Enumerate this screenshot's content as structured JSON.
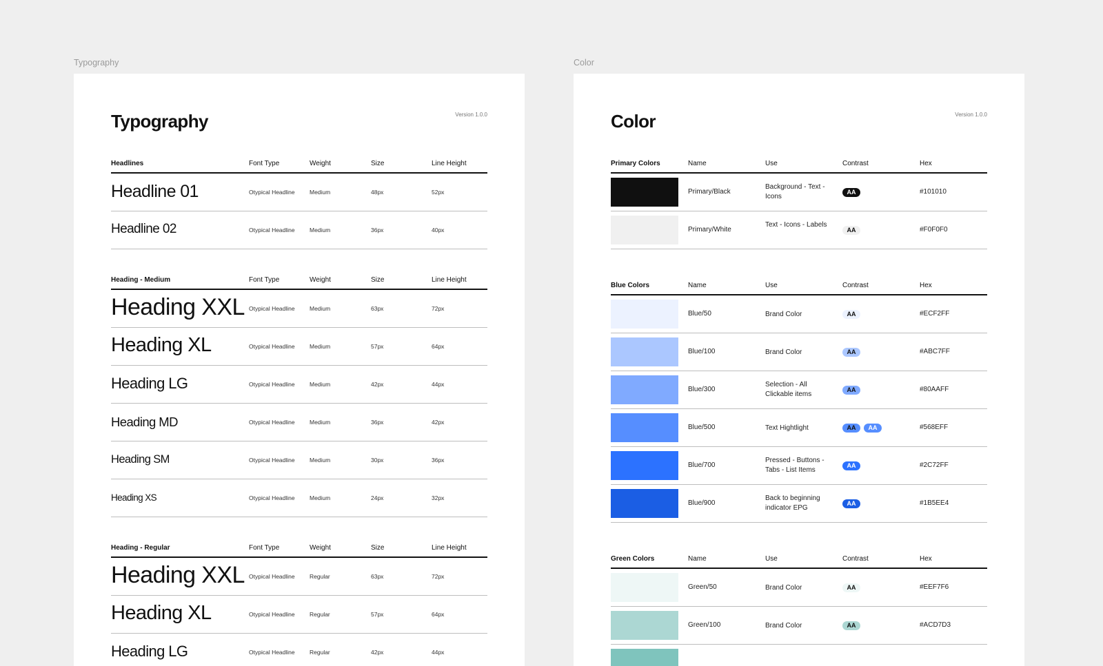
{
  "labels": {
    "typography": "Typography",
    "color": "Color"
  },
  "typography": {
    "title": "Typography",
    "version": "Version 1.0.0",
    "sections": [
      {
        "name": "Headlines",
        "cols": [
          "Font Type",
          "Weight",
          "Size",
          "Line Height"
        ],
        "rows": [
          {
            "sample": "Headline 01",
            "font": "Otypical Headline",
            "weight": "Medium",
            "size": "48px",
            "lh": "52px"
          },
          {
            "sample": "Headline 02",
            "font": "Otypical Headline",
            "weight": "Medium",
            "size": "36px",
            "lh": "40px"
          }
        ]
      },
      {
        "name": "Heading - Medium",
        "cols": [
          "Font Type",
          "Weight",
          "Size",
          "Line Height"
        ],
        "rows": [
          {
            "sample": "Heading XXL",
            "font": "Otypical Headline",
            "weight": "Medium",
            "size": "63px",
            "lh": "72px"
          },
          {
            "sample": "Heading XL",
            "font": "Otypical Headline",
            "weight": "Medium",
            "size": "57px",
            "lh": "64px"
          },
          {
            "sample": "Heading LG",
            "font": "Otypical Headline",
            "weight": "Medium",
            "size": "42px",
            "lh": "44px"
          },
          {
            "sample": "Heading MD",
            "font": "Otypical Headline",
            "weight": "Medium",
            "size": "36px",
            "lh": "42px"
          },
          {
            "sample": "Heading SM",
            "font": "Otypical Headline",
            "weight": "Medium",
            "size": "30px",
            "lh": "36px"
          },
          {
            "sample": "Heading XS",
            "font": "Otypical Headline",
            "weight": "Medium",
            "size": "24px",
            "lh": "32px"
          }
        ]
      },
      {
        "name": "Heading - Regular",
        "cols": [
          "Font Type",
          "Weight",
          "Size",
          "Line Height"
        ],
        "rows": [
          {
            "sample": "Heading XXL",
            "font": "Otypical Headline",
            "weight": "Regular",
            "size": "63px",
            "lh": "72px"
          },
          {
            "sample": "Heading XL",
            "font": "Otypical Headline",
            "weight": "Regular",
            "size": "57px",
            "lh": "64px"
          },
          {
            "sample": "Heading LG",
            "font": "Otypical Headline",
            "weight": "Regular",
            "size": "42px",
            "lh": "44px"
          }
        ]
      }
    ]
  },
  "color": {
    "title": "Color",
    "version": "Version 1.0.0",
    "sections": [
      {
        "name": "Primary Colors",
        "cols": [
          "Name",
          "Use",
          "Contrast",
          "Hex"
        ],
        "rows": [
          {
            "swatch": "#101010",
            "name": "Primary/Black",
            "use": "Background - Text - Icons",
            "aa": [
              {
                "label": "AA",
                "bg": "#101010",
                "fg": "#ffffff"
              }
            ],
            "hex": "#101010"
          },
          {
            "swatch": "#F0F0F0",
            "name": "Primary/White",
            "use": "Text - Icons - Labels",
            "aa": [
              {
                "label": "AA",
                "bg": "#F0F0F0",
                "fg": "#111111"
              }
            ],
            "hex": "#F0F0F0"
          }
        ]
      },
      {
        "name": "Blue Colors",
        "cols": [
          "Name",
          "Use",
          "Contrast",
          "Hex"
        ],
        "rows": [
          {
            "swatch": "#ECF2FF",
            "name": "Blue/50",
            "use": "Brand Color",
            "aa": [
              {
                "label": "AA",
                "bg": "#ECF2FF",
                "fg": "#111111"
              }
            ],
            "hex": "#ECF2FF"
          },
          {
            "swatch": "#ABC7FF",
            "name": "Blue/100",
            "use": "Brand Color",
            "aa": [
              {
                "label": "AA",
                "bg": "#ABC7FF",
                "fg": "#111111"
              }
            ],
            "hex": "#ABC7FF"
          },
          {
            "swatch": "#80AAFF",
            "name": "Blue/300",
            "use": "Selection - All Clickable items",
            "aa": [
              {
                "label": "AA",
                "bg": "#80AAFF",
                "fg": "#111111"
              }
            ],
            "hex": "#80AAFF"
          },
          {
            "swatch": "#568EFF",
            "name": "Blue/500",
            "use": "Text Hightlight",
            "aa": [
              {
                "label": "AA",
                "bg": "#568EFF",
                "fg": "#111111"
              },
              {
                "label": "AA",
                "bg": "#568EFF",
                "fg": "#ffffff"
              }
            ],
            "hex": "#568EFF"
          },
          {
            "swatch": "#2C72FF",
            "name": "Blue/700",
            "use": "Pressed - Buttons - Tabs - List Items",
            "aa": [
              {
                "label": "AA",
                "bg": "#2C72FF",
                "fg": "#ffffff"
              }
            ],
            "hex": "#2C72FF"
          },
          {
            "swatch": "#1B5EE4",
            "name": "Blue/900",
            "use": "Back to beginning indicator EPG",
            "aa": [
              {
                "label": "AA",
                "bg": "#1B5EE4",
                "fg": "#ffffff"
              }
            ],
            "hex": "#1B5EE4"
          }
        ]
      },
      {
        "name": "Green Colors",
        "cols": [
          "Name",
          "Use",
          "Contrast",
          "Hex"
        ],
        "rows": [
          {
            "swatch": "#EEF7F6",
            "name": "Green/50",
            "use": "Brand Color",
            "aa": [
              {
                "label": "AA",
                "bg": "#EEF7F6",
                "fg": "#111111"
              }
            ],
            "hex": "#EEF7F6"
          },
          {
            "swatch": "#ACD7D3",
            "name": "Green/100",
            "use": "Brand Color",
            "aa": [
              {
                "label": "AA",
                "bg": "#ACD7D3",
                "fg": "#111111"
              }
            ],
            "hex": "#ACD7D3"
          },
          {
            "swatch": "#7FC4BD",
            "name": "",
            "use": "",
            "aa": [],
            "hex": ""
          }
        ]
      }
    ]
  }
}
